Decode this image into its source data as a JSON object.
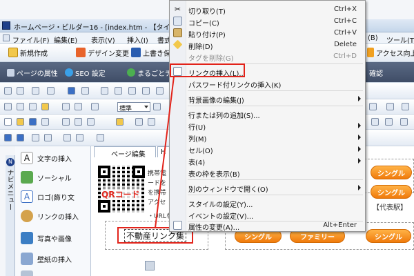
{
  "window": {
    "title": "ホームページ・ビルダー16 - [index.htm - 【タイ"
  },
  "menubar": {
    "items": [
      "ファイル(F)",
      "編集(E)",
      "表示(V)",
      "挿入(I)",
      "書式"
    ],
    "right_items": [
      "(B)",
      "ツール(T"
    ]
  },
  "toolbar1": {
    "new": "新規作成",
    "design_change": "デザイン変更",
    "overwrite_save": "上書き保",
    "access_up": "アクセス向上"
  },
  "toolbar2": {
    "page_props": "ページの属性",
    "seo": "SEO 設定",
    "matomete": "まるごとチェ",
    "check": "確認"
  },
  "format_select": "標準",
  "nav": {
    "vertical_label": "ナビメニュー",
    "items": [
      "文字の挿入",
      "ソーシャル",
      "ロゴ(飾り文",
      "リンクの挿入",
      "写真や画像",
      "壁紙の挿入",
      ""
    ]
  },
  "editor": {
    "tabs": [
      "ページ編集",
      "H"
    ],
    "qr_label": "QRコード",
    "side_text": [
      "携帯電",
      "ードを",
      "を携帯",
      "アクセ",
      "・URLを"
    ],
    "selected_text": "不動産リンク集",
    "buttons_right": [
      "シングル",
      "シングル"
    ],
    "buttons_bottom": [
      "シングル",
      "ファミリー",
      "シングル"
    ],
    "station_label": "【代表駅】"
  },
  "context_menu": {
    "items": [
      {
        "label": "切り取り(T)",
        "shortcut": "Ctrl+X",
        "icon": "scissors-icon",
        "disabled": false
      },
      {
        "label": "コピー(C)",
        "shortcut": "Ctrl+C",
        "icon": "copy-icon",
        "disabled": false
      },
      {
        "label": "貼り付け(P)",
        "shortcut": "Ctrl+V",
        "icon": "paste-icon",
        "disabled": false
      },
      {
        "label": "削除(D)",
        "shortcut": "Delete",
        "icon": "delete-icon",
        "disabled": false
      },
      {
        "label": "タグを削除(G)",
        "shortcut": "Ctrl+D",
        "icon": "",
        "disabled": true
      },
      {
        "label": "リンクの挿入(L)...",
        "shortcut": "",
        "icon": "link-insert-icon",
        "disabled": false
      },
      {
        "label": "パスワード付リンクの挿入(K)",
        "shortcut": "",
        "icon": "",
        "disabled": false
      },
      {
        "label": "背景画像の編集(J)",
        "shortcut": "",
        "icon": "",
        "disabled": false,
        "submenu": true
      },
      {
        "label": "行または列の追加(S)...",
        "shortcut": "",
        "icon": "",
        "disabled": false
      },
      {
        "label": "行(U)",
        "shortcut": "",
        "icon": "",
        "disabled": false,
        "submenu": true
      },
      {
        "label": "列(M)",
        "shortcut": "",
        "icon": "",
        "disabled": false,
        "submenu": true
      },
      {
        "label": "セル(O)",
        "shortcut": "",
        "icon": "",
        "disabled": false,
        "submenu": true
      },
      {
        "label": "表(4)",
        "shortcut": "",
        "icon": "",
        "disabled": false,
        "submenu": true
      },
      {
        "label": "表の枠を表示(B)",
        "shortcut": "",
        "icon": "",
        "disabled": false
      },
      {
        "label": "別のウィンドウで開く(O)",
        "shortcut": "",
        "icon": "",
        "disabled": false,
        "submenu": true
      },
      {
        "label": "スタイルの設定(Y)...",
        "shortcut": "",
        "icon": "",
        "disabled": false
      },
      {
        "label": "イベントの設定(V)...",
        "shortcut": "",
        "icon": "",
        "disabled": false
      },
      {
        "label": "属性の変更(A)...",
        "shortcut": "Alt+Enter",
        "icon": "properties-icon",
        "disabled": false
      }
    ]
  },
  "colors": {
    "highlight": "#e2231a",
    "orange": "#f07a0b",
    "accent_blue": "#1d3f8a"
  }
}
